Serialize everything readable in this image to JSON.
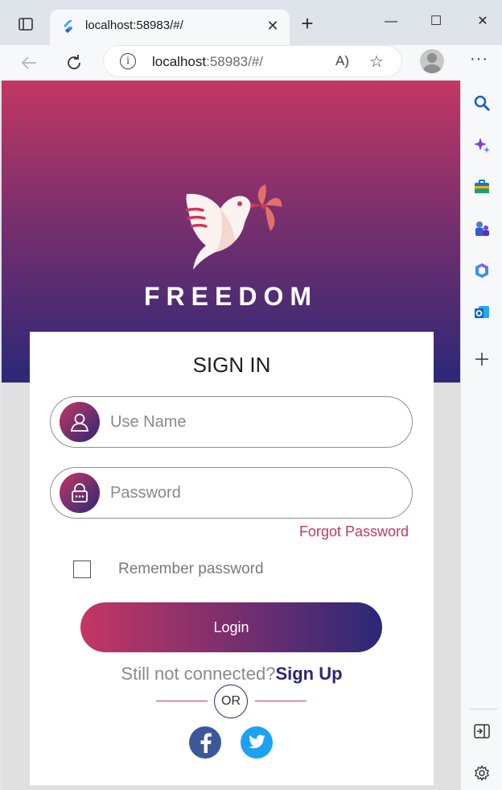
{
  "browser": {
    "tab_title": "localhost:58983/#/",
    "tab_close": "✕",
    "new_tab": "+",
    "window_minimize": "—",
    "window_maximize": "☐",
    "window_close": "✕",
    "url_host": "localhost",
    "url_rest": ":58983/#/",
    "info_glyph": "i",
    "read_aloud": "A)",
    "favorites": "☆",
    "menu": "···"
  },
  "sidebar": {
    "icons": [
      "search-icon",
      "copilot-icon",
      "tools-icon",
      "games-icon",
      "office-icon",
      "outlook-icon",
      "add-icon",
      "split-screen-icon",
      "settings-icon"
    ]
  },
  "app": {
    "brand": "FREEDOM",
    "sign_in_title": "SIGN IN",
    "username_placeholder": "Use Name",
    "password_placeholder": "Password",
    "forgot_password": "Forgot Password",
    "remember_password": "Remember password",
    "login_label": "Login",
    "signup_prefix": "Still not connected?",
    "signup_link": "Sign Up",
    "or_label": "OR",
    "social": [
      "facebook-icon",
      "twitter-icon"
    ]
  },
  "colors": {
    "primary": "#c33763",
    "secondary": "#2b2877",
    "facebook": "#3b5998",
    "twitter": "#1da1f2"
  }
}
